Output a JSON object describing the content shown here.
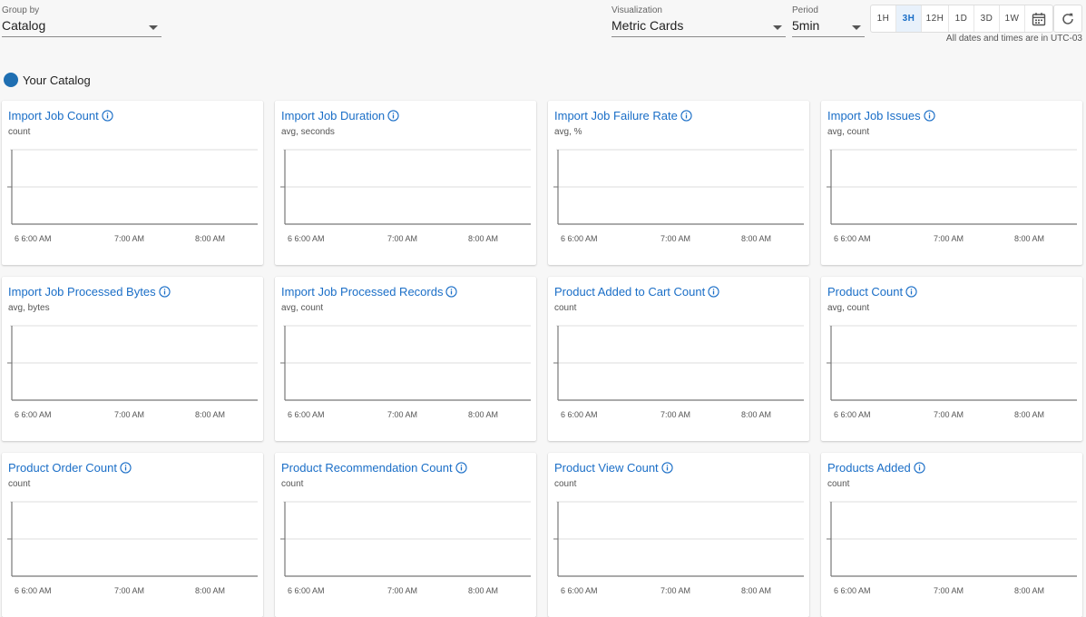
{
  "toolbar": {
    "group_by": {
      "label": "Group by",
      "value": "Catalog"
    },
    "visualization": {
      "label": "Visualization",
      "value": "Metric Cards"
    },
    "period": {
      "label": "Period",
      "value": "5min"
    },
    "ranges": [
      "1H",
      "3H",
      "12H",
      "1D",
      "3D",
      "1W"
    ],
    "active_range": "3H",
    "calendar_icon": "calendar-icon",
    "refresh_icon": "refresh-icon",
    "timezone_note": "All dates and times are in UTC-03"
  },
  "catalog": {
    "name": "Your Catalog",
    "color": "#1f6fb2"
  },
  "x_ticks": [
    "6 6:00 AM",
    "7:00 AM",
    "8:00 AM"
  ],
  "cards": [
    {
      "title": "Import Job Count",
      "subtitle": "count"
    },
    {
      "title": "Import Job Duration",
      "subtitle": "avg, seconds"
    },
    {
      "title": "Import Job Failure Rate",
      "subtitle": "avg, %"
    },
    {
      "title": "Import Job Issues",
      "subtitle": "avg, count"
    },
    {
      "title": "Import Job Processed Bytes",
      "subtitle": "avg, bytes"
    },
    {
      "title": "Import Job Processed Records",
      "subtitle": "avg, count"
    },
    {
      "title": "Product Added to Cart Count",
      "subtitle": "count"
    },
    {
      "title": "Product Count",
      "subtitle": "avg, count"
    },
    {
      "title": "Product Order Count",
      "subtitle": "count"
    },
    {
      "title": "Product Recommendation Count",
      "subtitle": "count"
    },
    {
      "title": "Product View Count",
      "subtitle": "count"
    },
    {
      "title": "Products Added",
      "subtitle": "count"
    }
  ],
  "colors": {
    "accent": "#1a6ec7",
    "axis": "#777777",
    "grid": "#dddddd"
  }
}
